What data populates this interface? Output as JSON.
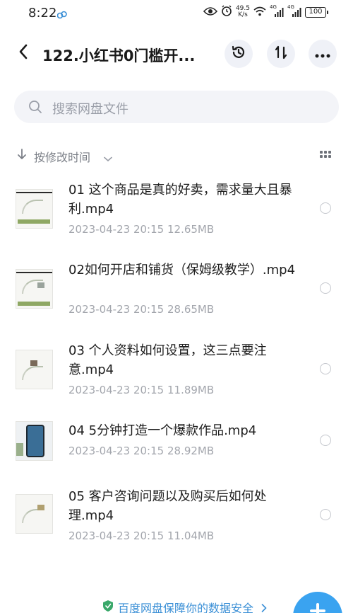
{
  "status_bar": {
    "time": "8:22",
    "net_speed_value": "49.5",
    "net_speed_unit": "K/s",
    "signal_1": "4G",
    "signal_2": "4G",
    "battery": "100"
  },
  "header": {
    "title": "122.小红书0门槛开...",
    "icons": [
      "back-arrow",
      "history",
      "sort-transfer",
      "more"
    ]
  },
  "search": {
    "placeholder": "搜索网盘文件"
  },
  "sort": {
    "label": "按修改时间"
  },
  "files": [
    {
      "name": "01 这个商品是真的好卖，需求量大且暴利.mp4",
      "date": "2023-04-23",
      "time": "20:15",
      "size": "12.65MB"
    },
    {
      "name": "02如何开店和铺货（保姆级教学）.mp4",
      "date": "2023-04-23",
      "time": "20:15",
      "size": "28.65MB"
    },
    {
      "name": "03 个人资料如何设置，这三点要注意.mp4",
      "date": "2023-04-23",
      "time": "20:15",
      "size": "11.89MB"
    },
    {
      "name": "04  5分钟打造一个爆款作品.mp4",
      "date": "2023-04-23",
      "time": "20:15",
      "size": "28.92MB"
    },
    {
      "name": "05 客户咨询问题以及购买后如何处理.mp4",
      "date": "2023-04-23",
      "time": "20:15",
      "size": "11.04MB"
    }
  ],
  "footer": {
    "text": "百度网盘保障你的数据安全"
  },
  "colors": {
    "accent": "#3aa3f0",
    "footer_link": "#3a8fd6",
    "meta_text": "#a3a6ad"
  }
}
